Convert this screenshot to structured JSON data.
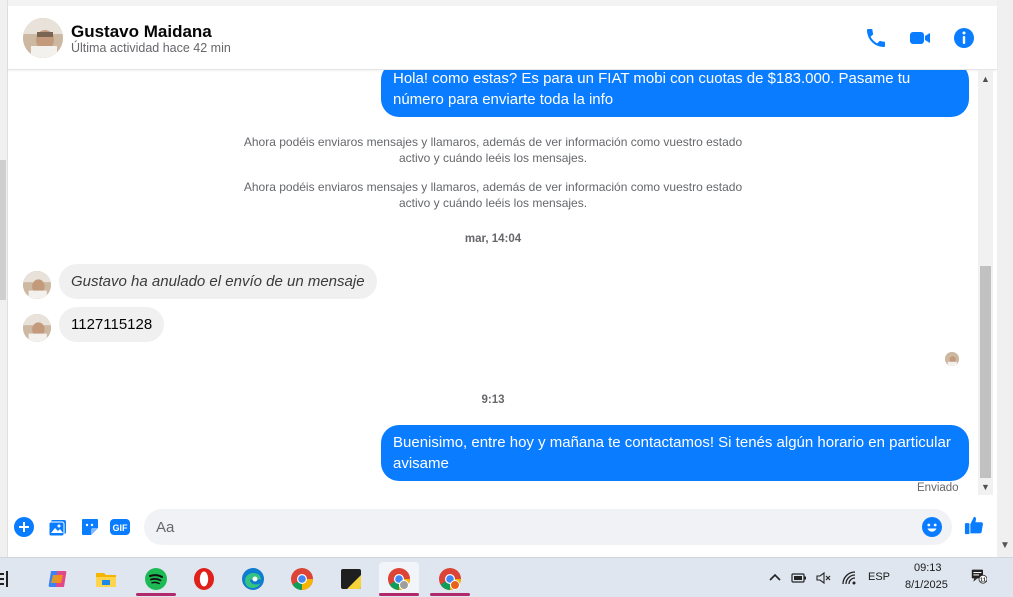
{
  "contact": {
    "name": "Gustavo Maidana",
    "status": "Última actividad hace 42 min"
  },
  "header_icons": [
    "phone-icon",
    "video-camera-icon",
    "info-icon"
  ],
  "messages": {
    "out_1": "Hola! como estas? Es para un FIAT mobi con cuotas de $183.000. Pasame tu número para enviarte toda la info",
    "system_1": "Ahora podéis enviaros mensajes y llamaros, además de ver información como vuestro estado activo y cuándo leéis los mensajes.",
    "system_2": "Ahora podéis enviaros mensajes y llamaros, además de ver información como vuestro estado activo y cuándo leéis los mensajes.",
    "time_1": "mar, 14:04",
    "in_1": "Gustavo ha anulado el envío de un mensaje",
    "in_2": "1127115128",
    "time_2": "9:13",
    "out_2": "Buenisimo, entre hoy y mañana te contactamos! Si tenés algún horario en particular avisame",
    "sent_status": "Enviado"
  },
  "composer": {
    "placeholder": "Aa",
    "icons": [
      "plus-icon",
      "image-icon",
      "sticker-icon",
      "gif-icon",
      "emoji-icon",
      "thumbs-up-icon"
    ],
    "gif_label": "GIF"
  },
  "taskbar": {
    "apps": [
      "task-view-icon",
      "copilot-icon",
      "file-explorer-icon",
      "spotify-icon",
      "opera-icon",
      "edge-icon",
      "chrome-icon",
      "sticky-notes-icon",
      "chrome-profile-1-icon",
      "chrome-profile-2-icon"
    ],
    "language": "ESP",
    "time": "09:13",
    "date": "8/1/2025",
    "notification_count": "11"
  },
  "colors": {
    "accent": "#0a7cff",
    "bubble_in": "#f0f0f0",
    "taskbar": "#dfe6f0"
  }
}
